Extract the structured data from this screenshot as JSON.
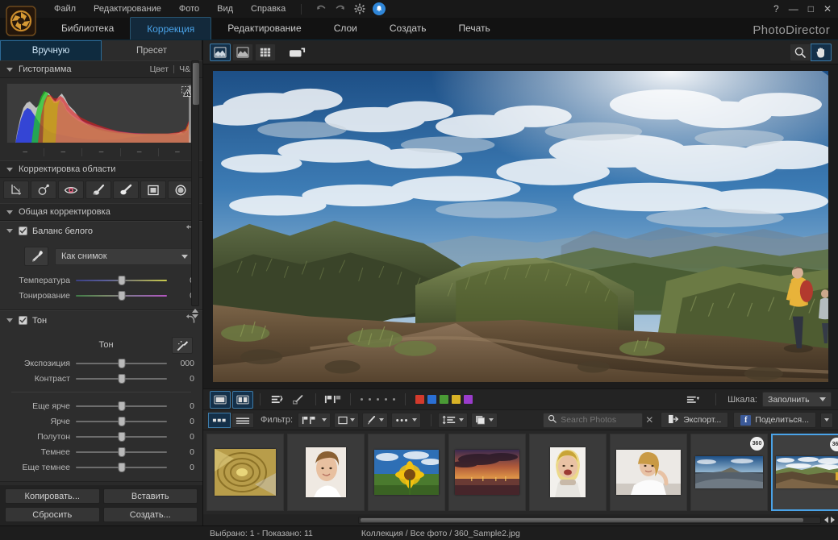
{
  "window": {
    "brand": "PhotoDirector",
    "controls": {
      "help": "?",
      "minimize": "—",
      "maximize": "□",
      "close": "✕"
    }
  },
  "menubar": {
    "items": [
      {
        "label": "Файл",
        "name": "menu-file"
      },
      {
        "label": "Редактирование",
        "name": "menu-edit"
      },
      {
        "label": "Фото",
        "name": "menu-photo"
      },
      {
        "label": "Вид",
        "name": "menu-view"
      },
      {
        "label": "Справка",
        "name": "menu-help"
      }
    ],
    "icons": [
      "undo-icon",
      "redo-icon",
      "gear-icon",
      "notification-bell-icon"
    ]
  },
  "module_tabs": [
    {
      "label": "Библиотека",
      "active": false
    },
    {
      "label": "Коррекция",
      "active": true
    },
    {
      "label": "Редактирование",
      "active": false
    },
    {
      "label": "Слои",
      "active": false
    },
    {
      "label": "Создать",
      "active": false
    },
    {
      "label": "Печать",
      "active": false
    }
  ],
  "left_panel": {
    "tabs": [
      {
        "label": "Вручную",
        "active": true
      },
      {
        "label": "Пресет",
        "active": false
      }
    ],
    "histogram": {
      "title": "Гистограмма",
      "mode_color": "Цвет",
      "mode_bw": "Ч&Б",
      "ticks": [
        "–",
        "–",
        "–",
        "–",
        "–"
      ],
      "warning_icon": "clipping-warning-icon"
    },
    "region_section": {
      "title": "Корректировка области",
      "tools": [
        {
          "name": "crop-rotate-tool",
          "glyph": "crop"
        },
        {
          "name": "spot-removal-tool",
          "glyph": "spot"
        },
        {
          "name": "red-eye-tool",
          "glyph": "eye"
        },
        {
          "name": "adjustment-brush-tool",
          "glyph": "brush1"
        },
        {
          "name": "brush-tool",
          "glyph": "brush2"
        },
        {
          "name": "gradient-mask-tool",
          "glyph": "rect"
        },
        {
          "name": "radial-mask-tool",
          "glyph": "circle"
        }
      ]
    },
    "global_section": {
      "title": "Общая корректировка"
    },
    "white_balance": {
      "title": "Баланс белого",
      "preset_value": "Как снимок",
      "eyedropper": "eyedropper-icon",
      "sliders": [
        {
          "label": "Температура",
          "value": "0",
          "pos": 50
        },
        {
          "label": "Тонирование",
          "value": "0",
          "pos": 50
        }
      ]
    },
    "tone": {
      "title": "Тон",
      "group_label": "Тон",
      "pin_icon": "auto-tone-icon",
      "sliders": [
        {
          "label": "Экспозиция",
          "value": "000",
          "pos": 50
        },
        {
          "label": "Контраст",
          "value": "0",
          "pos": 50
        }
      ],
      "sliders2": [
        {
          "label": "Еще ярче",
          "value": "0",
          "pos": 50
        },
        {
          "label": "Ярче",
          "value": "0",
          "pos": 50
        },
        {
          "label": "Полутон",
          "value": "0",
          "pos": 50
        },
        {
          "label": "Темнее",
          "value": "0",
          "pos": 50
        },
        {
          "label": "Еще темнее",
          "value": "0",
          "pos": 50
        }
      ]
    },
    "footer_buttons": [
      {
        "label": "Копировать...",
        "name": "copy-button"
      },
      {
        "label": "Вставить",
        "name": "paste-button"
      },
      {
        "label": "Сбросить",
        "name": "reset-button"
      },
      {
        "label": "Создать...",
        "name": "create-button"
      }
    ]
  },
  "viewer": {
    "left_tools": [
      {
        "name": "view-single-photo",
        "active": true
      },
      {
        "name": "view-compare",
        "active": false
      },
      {
        "name": "view-grid",
        "active": false
      },
      {
        "name": "view-fullscreen",
        "active": false
      }
    ],
    "right_tools": [
      {
        "name": "zoom-tool",
        "active": false
      },
      {
        "name": "pan-hand-tool",
        "active": true
      }
    ]
  },
  "under_toolbar": {
    "buttons": [
      {
        "name": "before-after-single"
      },
      {
        "name": "before-after-split"
      },
      {
        "name": "sort-order-button"
      },
      {
        "name": "rating-pencil-button"
      },
      {
        "name": "flag-buttons"
      }
    ],
    "rating_dots": 5,
    "color_swatches": [
      "#d33a2c",
      "#2a6fd4",
      "#4a9a35",
      "#d8b226",
      "#9a3ccb"
    ],
    "scale_label": "Шкала:",
    "scale_value": "Заполнить"
  },
  "strip_toolbar": {
    "view_toggles": [
      {
        "name": "thumbnail-view-toggle",
        "active": true
      },
      {
        "name": "list-view-toggle",
        "active": false
      }
    ],
    "filter_label": "Фильтр:",
    "filter_buttons": [
      {
        "name": "filter-flag-dropdown"
      },
      {
        "name": "filter-rating-dropdown"
      },
      {
        "name": "filter-tag-dropdown"
      },
      {
        "name": "filter-more-dropdown"
      }
    ],
    "sort_buttons": [
      {
        "name": "sort-dropdown"
      },
      {
        "name": "stack-dropdown"
      }
    ],
    "search": {
      "placeholder": "Search Photos",
      "value": "",
      "icon": "search-icon",
      "clear": "✕"
    },
    "export_label": "Экспорт...",
    "share_label": "Поделиться..."
  },
  "filmstrip": {
    "thumbnails": [
      {
        "name": "thumb-spiral-stairs",
        "kind": "spiral",
        "selected": false,
        "badge": ""
      },
      {
        "name": "thumb-woman-smiling",
        "kind": "portrait1",
        "selected": false,
        "badge": ""
      },
      {
        "name": "thumb-sunflower",
        "kind": "sunflower",
        "selected": false,
        "badge": ""
      },
      {
        "name": "thumb-sunset-harbor",
        "kind": "sunset",
        "selected": false,
        "badge": ""
      },
      {
        "name": "thumb-girl-laughing",
        "kind": "portrait2",
        "selected": false,
        "badge": ""
      },
      {
        "name": "thumb-woman-desk",
        "kind": "portrait3",
        "selected": false,
        "badge": ""
      },
      {
        "name": "thumb-360-road",
        "kind": "pano1",
        "selected": false,
        "badge": "360"
      },
      {
        "name": "thumb-360-mountain",
        "kind": "pano2",
        "selected": true,
        "badge": "360"
      }
    ]
  },
  "status_bar": {
    "selection": "Выбрано: 1 - Показано: 11",
    "path": "Коллекция / Все фото / 360_Sample2.jpg"
  }
}
